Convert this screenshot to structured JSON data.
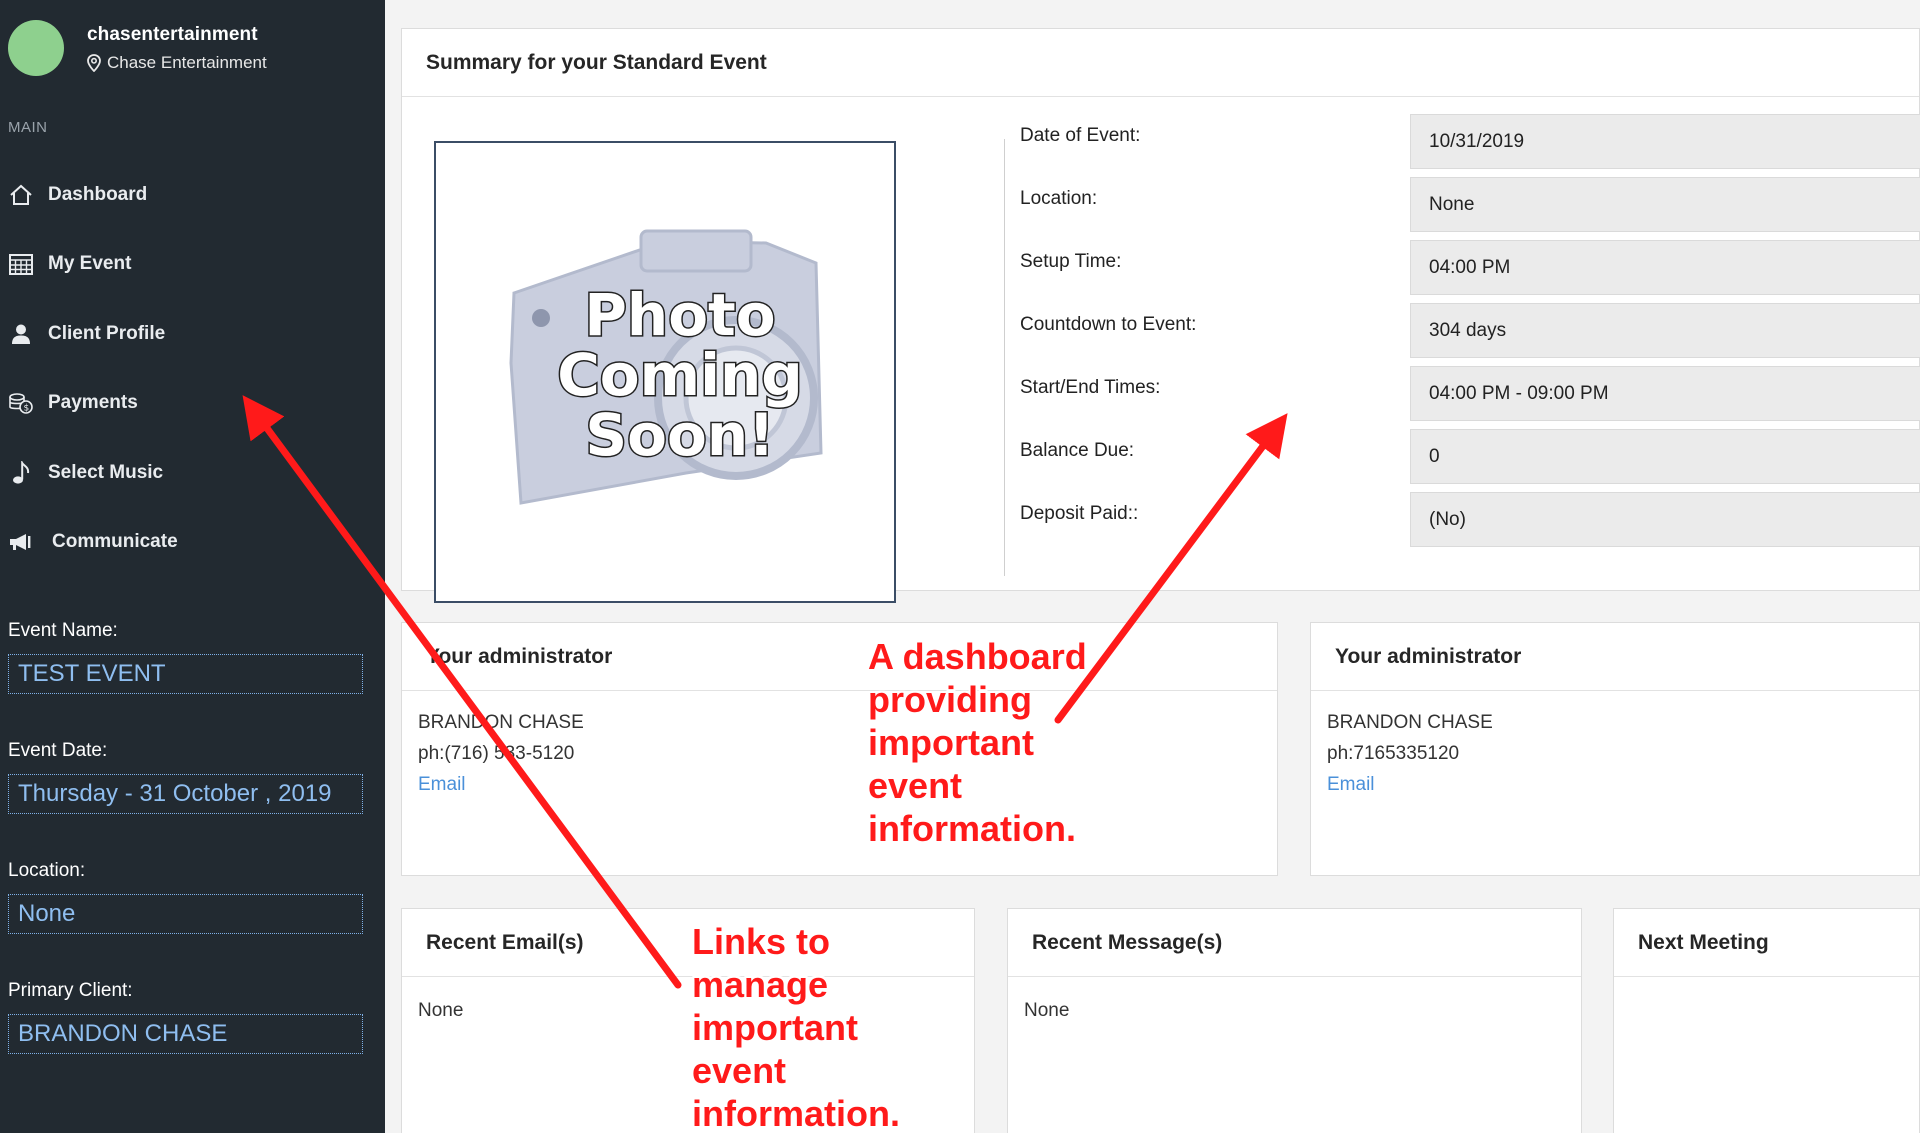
{
  "sidebar": {
    "username": "chasentertainment",
    "company": "Chase Entertainment",
    "section_label": "MAIN",
    "nav": [
      {
        "label": "Dashboard",
        "icon": "home-icon"
      },
      {
        "label": "My Event",
        "icon": "calendar-icon"
      },
      {
        "label": "Client Profile",
        "icon": "user-icon"
      },
      {
        "label": "Payments",
        "icon": "coins-icon"
      },
      {
        "label": "Select Music",
        "icon": "music-note-icon"
      },
      {
        "label": "Communicate",
        "icon": "megaphone-icon"
      }
    ],
    "event_name_label": "Event Name:",
    "event_name": "TEST EVENT",
    "event_date_label": "Event Date:",
    "event_date": "Thursday - 31 October , 2019",
    "location_label": "Location:",
    "location": "None",
    "primary_client_label": "Primary Client:",
    "primary_client": "BRANDON CHASE"
  },
  "summary": {
    "title": "Summary for your Standard Event",
    "photo_placeholder": [
      "Photo",
      "Coming",
      "Soon!"
    ],
    "fields": [
      {
        "label": "Date of Event:",
        "value": "10/31/2019"
      },
      {
        "label": "Location:",
        "value": "None"
      },
      {
        "label": "Setup Time:",
        "value": "04:00 PM"
      },
      {
        "label": "Countdown to Event:",
        "value": "304 days"
      },
      {
        "label": "Start/End Times:",
        "value": "04:00 PM - 09:00 PM"
      },
      {
        "label": "Balance Due:",
        "value": "0"
      },
      {
        "label": "Deposit Paid::",
        "value": "(No)"
      }
    ]
  },
  "admin_left": {
    "title": "Your administrator",
    "name": "BRANDON CHASE",
    "phone": "ph:(716) 533-5120",
    "email_link": "Email"
  },
  "admin_right": {
    "title": "Your administrator",
    "name": "BRANDON CHASE",
    "phone": "ph:7165335120",
    "email_link": "Email"
  },
  "recent_emails": {
    "title": "Recent Email(s)",
    "body": "None"
  },
  "recent_messages": {
    "title": "Recent Message(s)",
    "body": "None"
  },
  "next_meeting": {
    "title": "Next Meeting"
  },
  "annotations": {
    "dashboard": [
      "A dashboard",
      "providing",
      "important",
      "event",
      "information."
    ],
    "links": [
      "Links to",
      "manage",
      "important",
      "event",
      "information."
    ]
  },
  "colors": {
    "sidebar_bg": "#222a31",
    "accent_link": "#4a90d9",
    "sidebar_value": "#8fbef0",
    "annotation_red": "#ff1a1a",
    "avatar": "#8ed08e"
  }
}
